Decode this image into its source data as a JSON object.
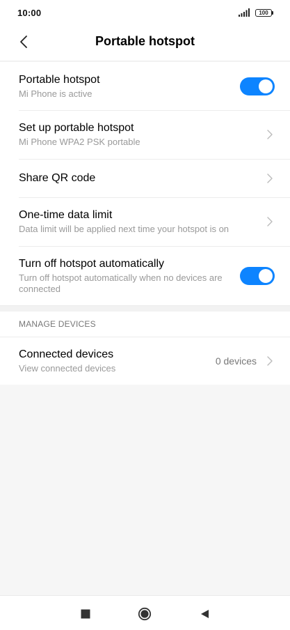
{
  "status_bar": {
    "time": "10:00",
    "battery": "100",
    "signal_icon": "signal-icon"
  },
  "header": {
    "title": "Portable hotspot",
    "back_icon": "back-icon"
  },
  "settings": [
    {
      "id": "portable-hotspot",
      "title": "Portable hotspot",
      "subtitle": "Mi Phone is active",
      "control": "toggle",
      "toggle_on": true
    },
    {
      "id": "setup-hotspot",
      "title": "Set up portable hotspot",
      "subtitle": "Mi Phone WPA2 PSK portable",
      "control": "chevron"
    },
    {
      "id": "share-qr",
      "title": "Share QR code",
      "control": "chevron"
    },
    {
      "id": "data-limit",
      "title": "One-time data limit",
      "subtitle": "Data limit will be applied next time your hotspot is on",
      "control": "chevron"
    },
    {
      "id": "auto-off",
      "title": "Turn off hotspot automatically",
      "subtitle": "Turn off hotspot automatically when no devices are connected",
      "control": "toggle",
      "toggle_on": true
    }
  ],
  "manage_devices": {
    "section_title": "MANAGE DEVICES",
    "connected": {
      "title": "Connected devices",
      "subtitle": "View connected devices",
      "value": "0 devices"
    }
  },
  "nav_bar": {
    "items": [
      "recents-icon",
      "home-icon",
      "back-triangle-icon"
    ]
  },
  "colors": {
    "accent": "#0d84ff",
    "background": "#f6f6f6",
    "subtitle": "#999999"
  }
}
